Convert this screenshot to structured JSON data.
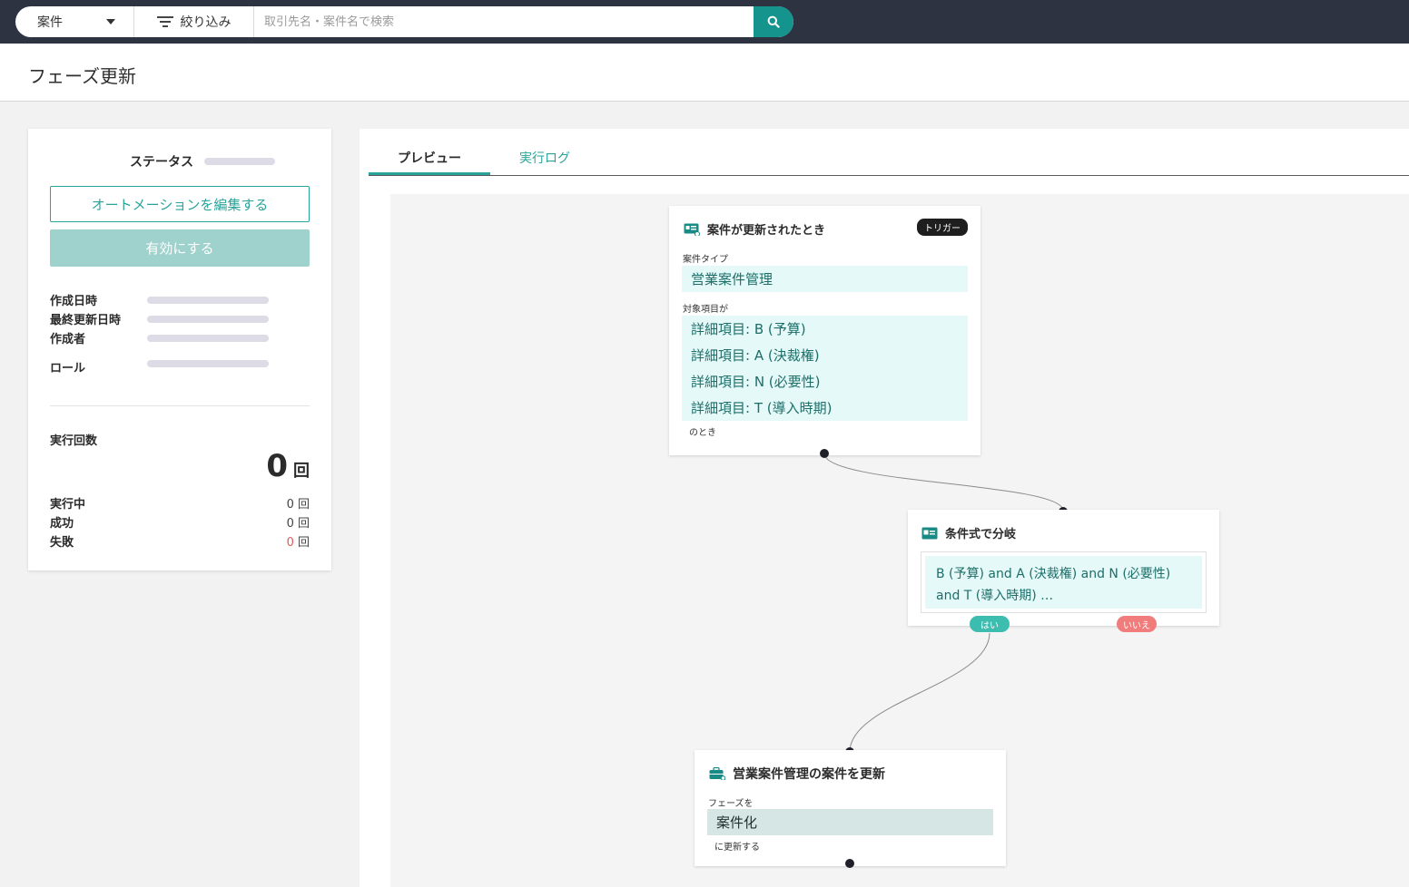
{
  "topbar": {
    "type_select": "案件",
    "filter_label": "絞り込み",
    "search_placeholder": "取引先名・案件名で検索"
  },
  "header": {
    "title": "フェーズ更新"
  },
  "left_panel": {
    "status_label": "ステータス",
    "edit_button": "オートメーションを編集する",
    "enable_button": "有効にする",
    "meta": [
      {
        "label": "作成日時"
      },
      {
        "label": "最終更新日時"
      },
      {
        "label": "作成者"
      },
      {
        "label": "ロール"
      }
    ],
    "exec_count_title": "実行回数",
    "exec_total": "0",
    "exec_unit": "回",
    "stats": [
      {
        "label": "実行中",
        "value": "0 回"
      },
      {
        "label": "成功",
        "value": "0 回"
      },
      {
        "label": "失敗",
        "value_num": "0",
        "value_unit": " 回"
      }
    ]
  },
  "tabs": [
    {
      "label": "プレビュー",
      "active": true
    },
    {
      "label": "実行ログ",
      "active": false
    }
  ],
  "flow": {
    "trigger": {
      "title": "案件が更新されたとき",
      "badge": "トリガー",
      "type_label": "案件タイプ",
      "type_value": "営業案件管理",
      "target_label": "対象項目が",
      "targets": [
        "詳細項目: B (予算)",
        "詳細項目: A (決裁権)",
        "詳細項目: N (必要性)",
        "詳細項目: T (導入時期)"
      ],
      "suffix": "のとき"
    },
    "branch": {
      "title": "条件式で分岐",
      "condition_line1": "B (予算) and A (決裁権) and N (必要性)",
      "condition_line2": "and T (導入時期) …",
      "yes_label": "はい",
      "no_label": "いいえ"
    },
    "action": {
      "title": "営業案件管理の案件を更新",
      "field_label": "フェーズを",
      "field_value": "案件化",
      "suffix": "に更新する"
    }
  },
  "colors": {
    "accent": "#2aa39b",
    "topbar_bg": "#2d3340",
    "chip_bg": "#e4f9f8",
    "no_pill": "#f07c7c",
    "yes_pill": "#3dbdb0"
  }
}
